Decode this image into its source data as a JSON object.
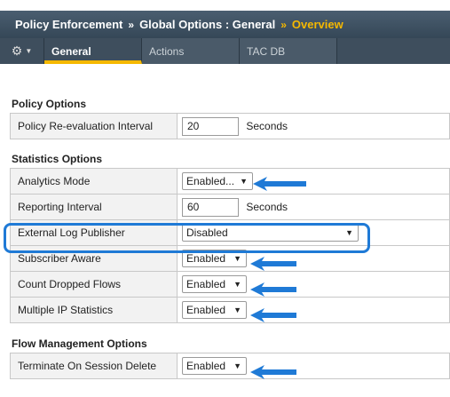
{
  "breadcrumb": {
    "items": [
      "Policy Enforcement",
      "Global Options : General"
    ],
    "current": "Overview",
    "separator": "»"
  },
  "tabs": [
    {
      "label": "General",
      "active": true
    },
    {
      "label": "Actions",
      "active": false
    },
    {
      "label": "TAC DB",
      "active": false
    }
  ],
  "gear_menu": {
    "icon": "gear-icon"
  },
  "policy_options": {
    "title": "Policy Options",
    "reevaluation": {
      "label": "Policy Re-evaluation Interval",
      "value": "20",
      "unit": "Seconds"
    }
  },
  "statistics_options": {
    "title": "Statistics Options",
    "analytics_mode": {
      "label": "Analytics Mode",
      "value": "Enabled..."
    },
    "reporting_interval": {
      "label": "Reporting Interval",
      "value": "60",
      "unit": "Seconds"
    },
    "external_log_publisher": {
      "label": "External Log Publisher",
      "value": "Disabled"
    },
    "subscriber_aware": {
      "label": "Subscriber Aware",
      "value": "Enabled"
    },
    "count_dropped_flows": {
      "label": "Count Dropped Flows",
      "value": "Enabled"
    },
    "multiple_ip_statistics": {
      "label": "Multiple IP Statistics",
      "value": "Enabled"
    }
  },
  "flow_management_options": {
    "title": "Flow Management Options",
    "terminate_on_session_delete": {
      "label": "Terminate On Session Delete",
      "value": "Enabled"
    }
  },
  "colors": {
    "annotation_blue": "#1f7ad6",
    "accent_yellow": "#f5b800",
    "header_bg": "#3e4e5d"
  }
}
